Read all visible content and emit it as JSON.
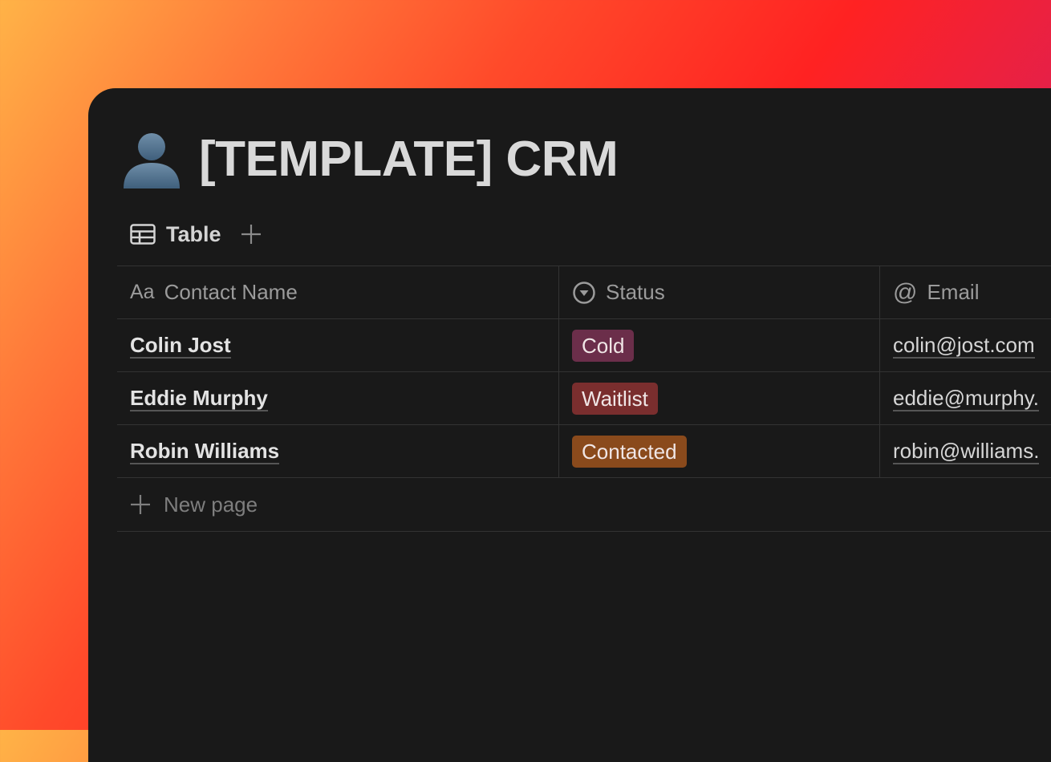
{
  "page": {
    "title": "[TEMPLATE] CRM",
    "title_icon": "person-silhouette-icon"
  },
  "views": {
    "active_tab": {
      "label": "Table",
      "icon": "table-icon"
    },
    "add_icon": "plus-icon"
  },
  "table": {
    "columns": [
      {
        "label": "Contact Name",
        "icon": "Aa"
      },
      {
        "label": "Status",
        "icon": "select-icon"
      },
      {
        "label": "Email",
        "icon": "@"
      }
    ],
    "rows": [
      {
        "name": "Colin Jost",
        "status": "Cold",
        "email": "colin@jost.com"
      },
      {
        "name": "Eddie Murphy",
        "status": "Waitlist",
        "email": "eddie@murphy."
      },
      {
        "name": "Robin Williams",
        "status": "Contacted",
        "email": "robin@williams."
      }
    ],
    "new_page_label": "New page"
  },
  "colors": {
    "background": "#191919",
    "status_cold": "#6b2e4a",
    "status_waitlist": "#7a2e2e",
    "status_contacted": "#8a4a1c"
  }
}
